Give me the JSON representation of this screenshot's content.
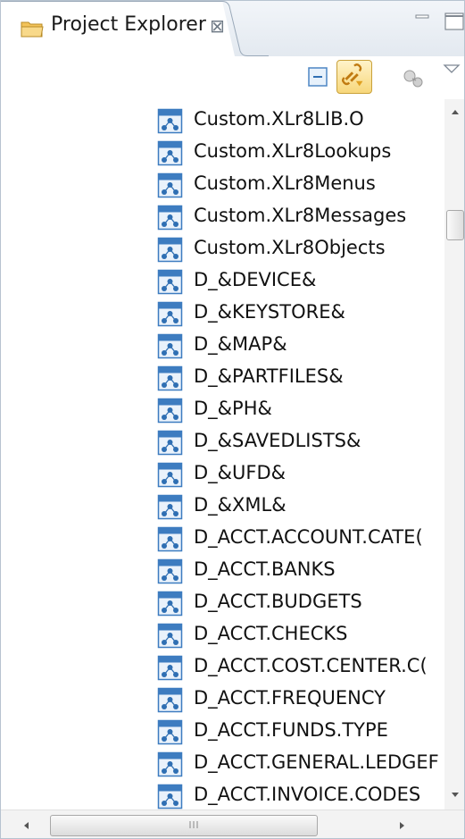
{
  "view": {
    "title": "Project Explorer",
    "close_glyph": "⊠",
    "icons": {
      "tab": "folder-icon",
      "minimize": "minimize-icon",
      "maximize": "maximize-icon"
    }
  },
  "toolbar": {
    "buttons": [
      {
        "name": "collapse-all-button",
        "icon": "collapse-all-icon"
      },
      {
        "name": "link-with-editor-button",
        "icon": "link-with-editor-icon",
        "active": true
      },
      {
        "name": "focus-button",
        "icon": "focus-icon"
      },
      {
        "name": "view-menu-button",
        "icon": "view-menu-icon"
      }
    ]
  },
  "tree": {
    "row_icon": "table-icon",
    "items": [
      {
        "label": "Custom.XLr8LIB.O"
      },
      {
        "label": "Custom.XLr8Lookups"
      },
      {
        "label": "Custom.XLr8Menus"
      },
      {
        "label": "Custom.XLr8Messages"
      },
      {
        "label": "Custom.XLr8Objects"
      },
      {
        "label": "D_&DEVICE&"
      },
      {
        "label": "D_&KEYSTORE&"
      },
      {
        "label": "D_&MAP&"
      },
      {
        "label": "D_&PARTFILES&"
      },
      {
        "label": "D_&PH&"
      },
      {
        "label": "D_&SAVEDLISTS&"
      },
      {
        "label": "D_&UFD&"
      },
      {
        "label": "D_&XML&"
      },
      {
        "label": "D_ACCT.ACCOUNT.CATE("
      },
      {
        "label": "D_ACCT.BANKS"
      },
      {
        "label": "D_ACCT.BUDGETS"
      },
      {
        "label": "D_ACCT.CHECKS"
      },
      {
        "label": "D_ACCT.COST.CENTER.C("
      },
      {
        "label": "D_ACCT.FREQUENCY"
      },
      {
        "label": "D_ACCT.FUNDS.TYPE"
      },
      {
        "label": "D_ACCT.GENERAL.LEDGEF"
      },
      {
        "label": "D_ACCT.INVOICE.CODES"
      }
    ]
  },
  "scrollbars": {
    "hscroll_grip_glyph": "III"
  },
  "colors": {
    "tab_border": "#9aa9b9",
    "icon_blue": "#2f6fb3",
    "accent_orange": "#e0a020"
  }
}
